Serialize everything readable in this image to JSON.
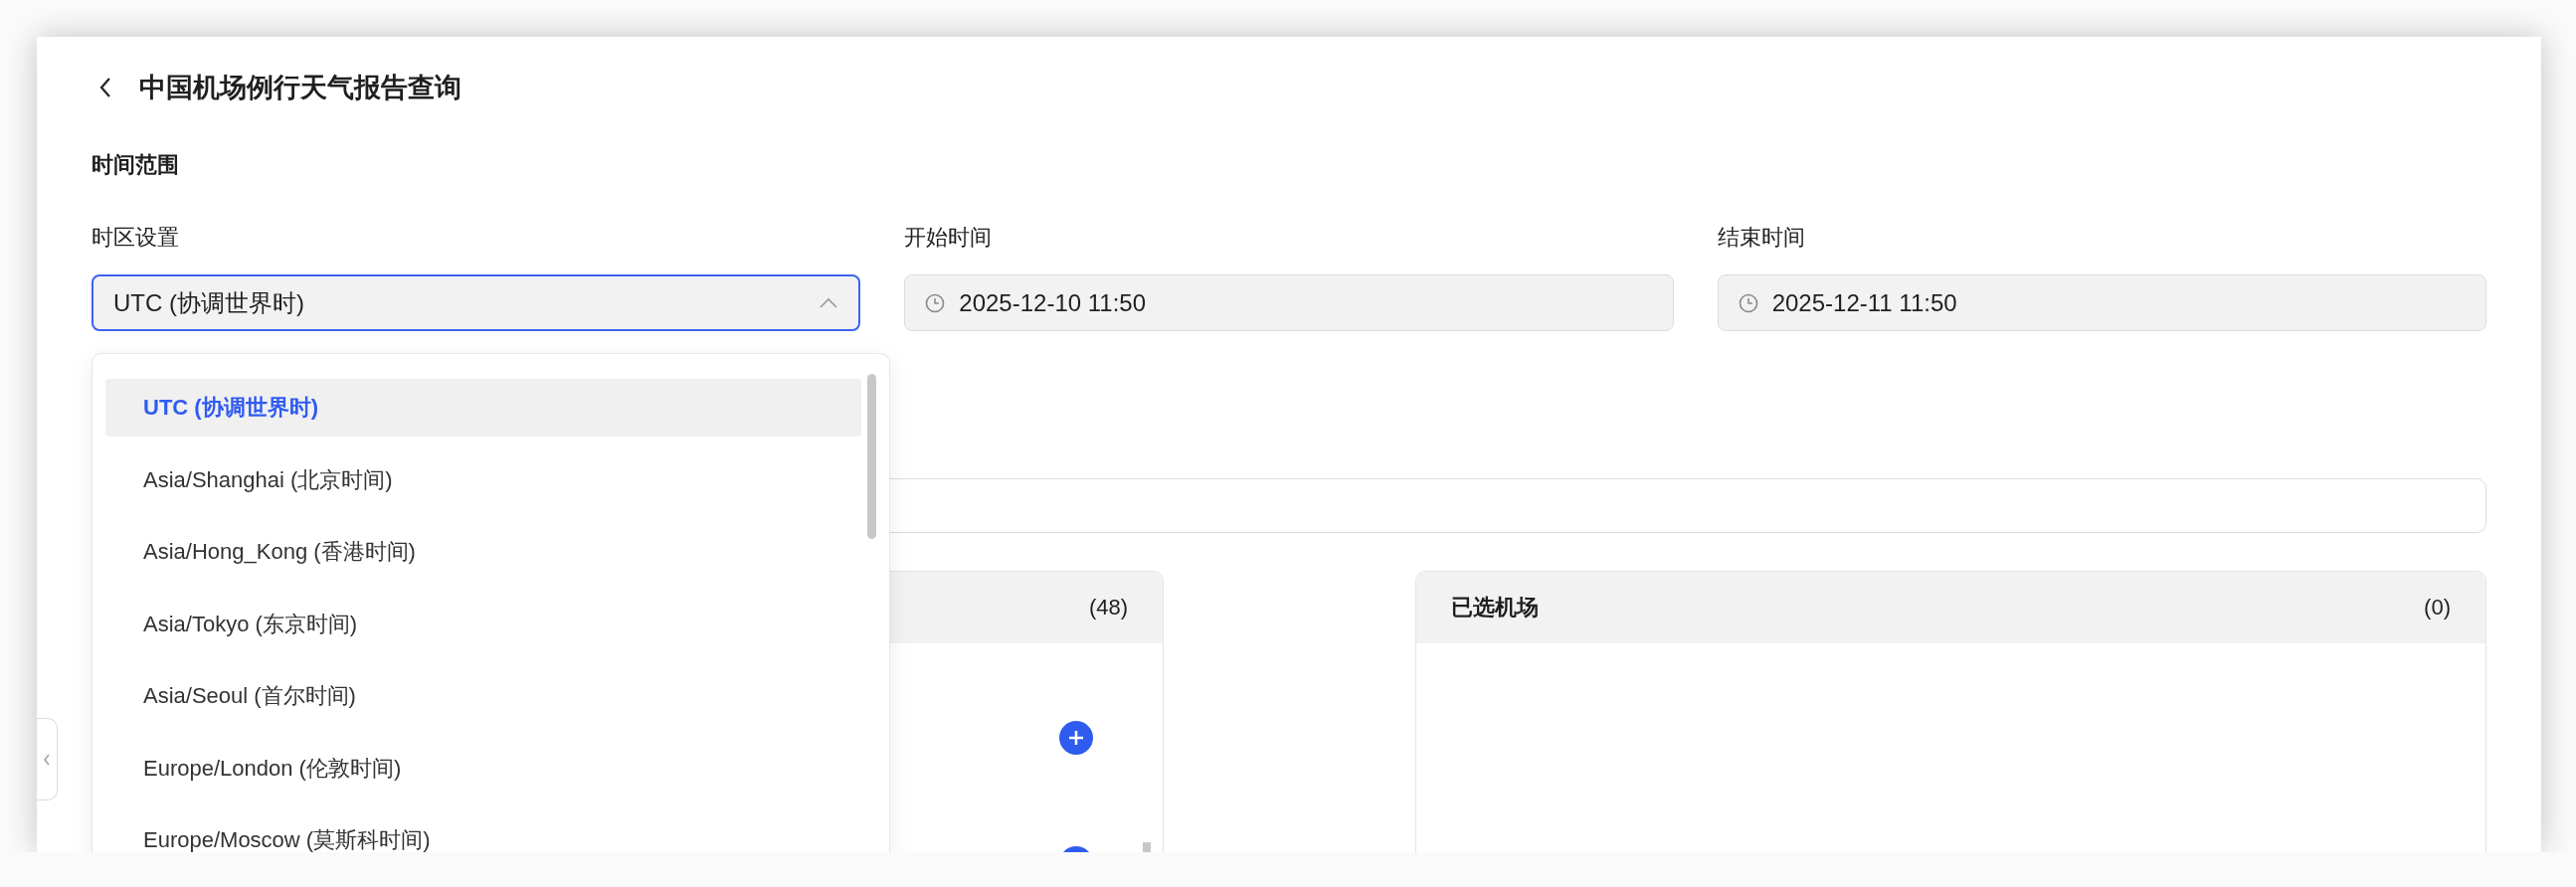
{
  "header": {
    "title": "中国机场例行天气报告查询"
  },
  "section_title": "时间范围",
  "fields": [
    {
      "kind": "select",
      "label": "时区设置",
      "value": "UTC (协调世界时)",
      "expanded": true
    },
    {
      "kind": "datetime",
      "label": "开始时间",
      "value": "2025-12-10 11:50"
    },
    {
      "kind": "datetime",
      "label": "结束时间",
      "value": "2025-12-11 11:50"
    }
  ],
  "timezone_options": [
    {
      "label": "UTC (协调世界时)",
      "selected": true
    },
    {
      "label": "Asia/Shanghai (北京时间)",
      "selected": false
    },
    {
      "label": "Asia/Hong_Kong (香港时间)",
      "selected": false
    },
    {
      "label": "Asia/Tokyo (东京时间)",
      "selected": false
    },
    {
      "label": "Asia/Seoul (首尔时间)",
      "selected": false
    },
    {
      "label": "Europe/London (伦敦时间)",
      "selected": false
    },
    {
      "label": "Europe/Moscow (莫斯科时间)",
      "selected": false
    }
  ],
  "available_panel": {
    "count": "(48)"
  },
  "selected_panel": {
    "title": "已选机场",
    "count": "(0)"
  }
}
